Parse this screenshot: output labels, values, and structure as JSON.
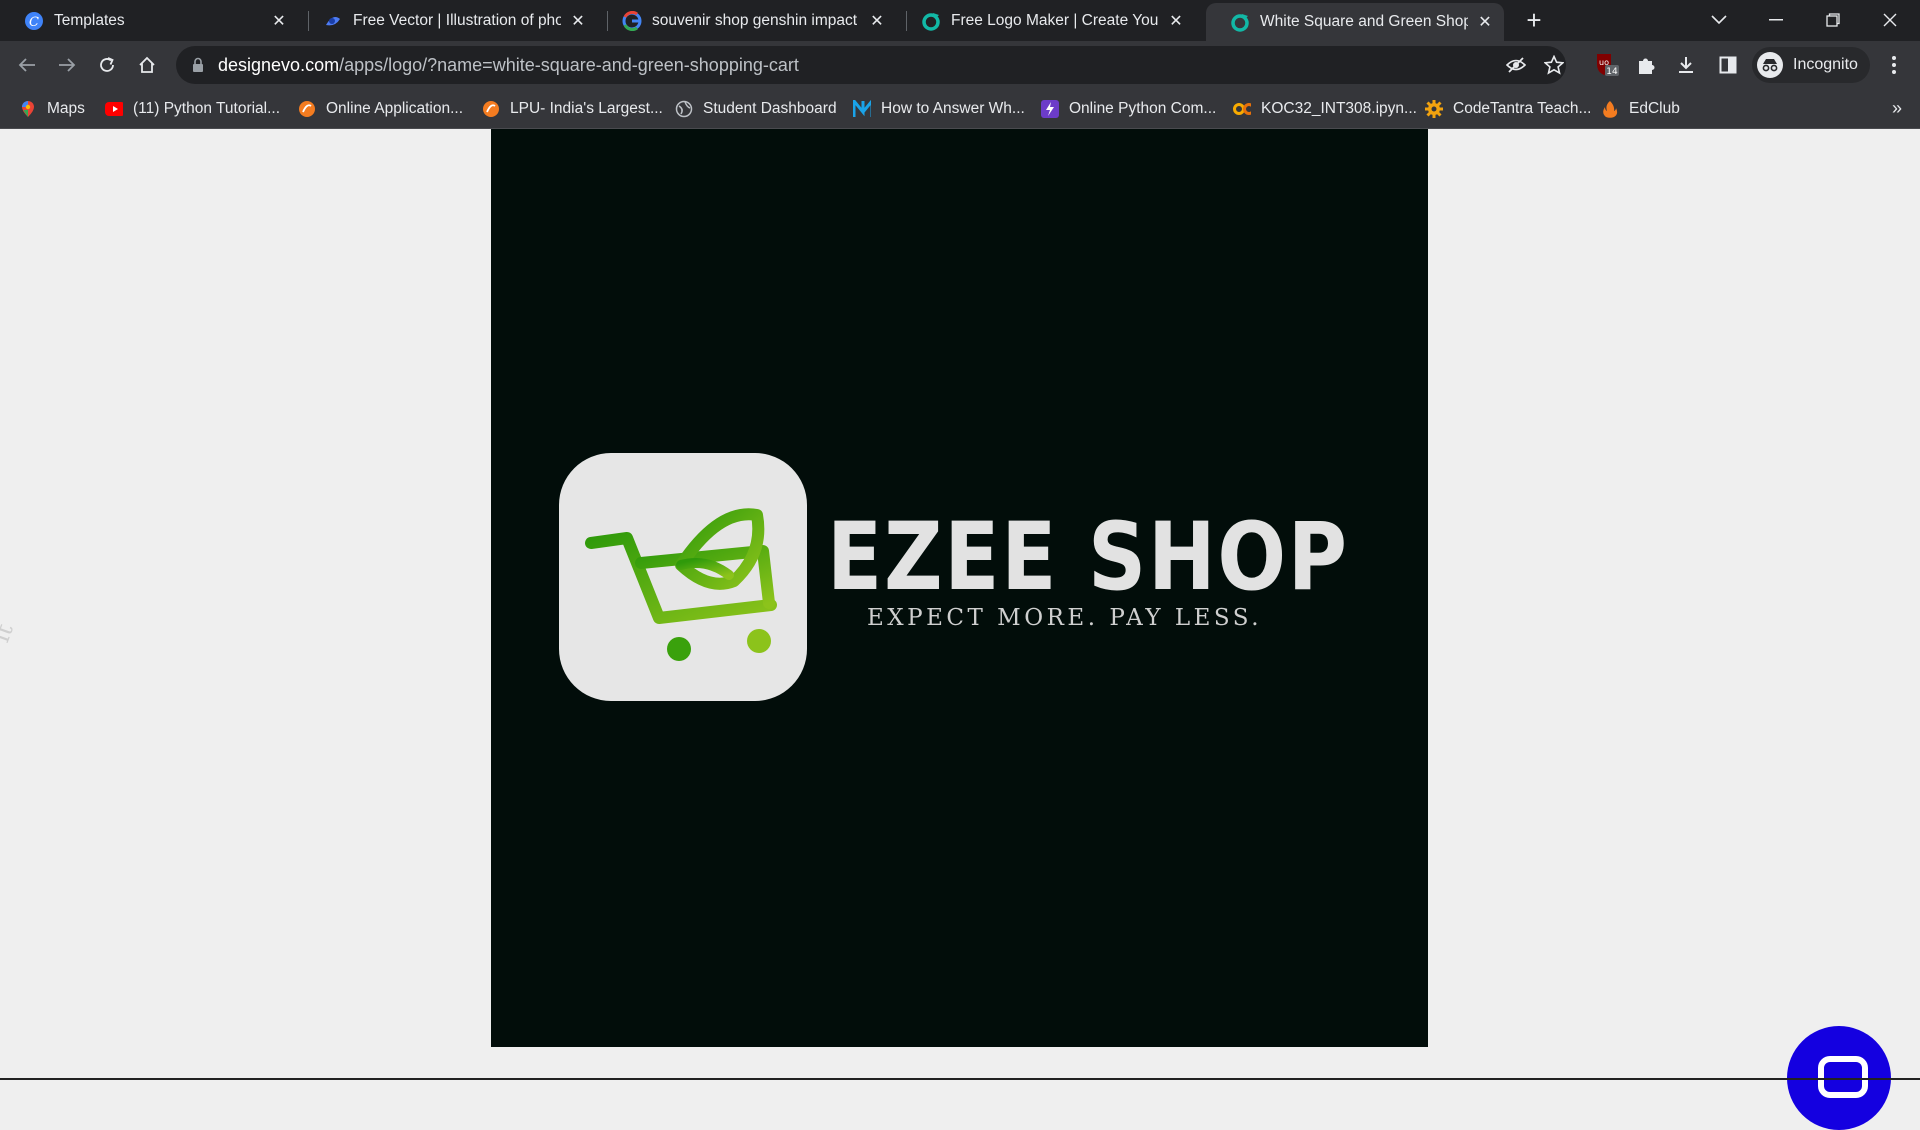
{
  "tabs": [
    {
      "title": "Templates",
      "favicon": "canva-icon",
      "active": false
    },
    {
      "title": "Free Vector | Illustration of photo",
      "favicon": "freepik-icon",
      "active": false
    },
    {
      "title": "souvenir shop genshin impact - G",
      "favicon": "google-icon",
      "active": false
    },
    {
      "title": "Free Logo Maker | Create Your Lo",
      "favicon": "designevo-icon",
      "active": false
    },
    {
      "title": "White Square and Green Shoppin",
      "favicon": "designevo-icon",
      "active": true
    }
  ],
  "address": {
    "host": "designevo.com",
    "path": "/apps/logo/?name=white-square-and-green-shopping-cart"
  },
  "profile": {
    "label": "Incognito"
  },
  "extension_badge": "14",
  "bookmarks": [
    {
      "label": "Maps",
      "icon": "maps-icon"
    },
    {
      "label": "(11) Python Tutorial...",
      "icon": "youtube-icon"
    },
    {
      "label": "Online Application...",
      "icon": "lpu-icon"
    },
    {
      "label": "LPU- India's Largest...",
      "icon": "lpu-icon"
    },
    {
      "label": "Student Dashboard",
      "icon": "globe-icon"
    },
    {
      "label": "How to Answer Wh...",
      "icon": "n-logo-icon"
    },
    {
      "label": "Online Python Com...",
      "icon": "bolt-icon"
    },
    {
      "label": "KOC32_INT308.ipyn...",
      "icon": "colab-icon"
    },
    {
      "label": "CodeTantra Teach...",
      "icon": "gear-icon"
    },
    {
      "label": "EdClub",
      "icon": "flame-icon"
    }
  ],
  "logo": {
    "brand": "EZEE SHOP",
    "tagline": "EXPECT MORE. PAY LESS.",
    "bg_color": "#020d0a",
    "tile_color": "#e6e6e6",
    "cart_colors": [
      "#3aa10c",
      "#8cc31b"
    ]
  },
  "side_ghost_text": "it",
  "colors": {
    "chrome_dark": "#202124",
    "chrome_toolbar": "#35363a",
    "help_bubble": "#1400e0"
  }
}
